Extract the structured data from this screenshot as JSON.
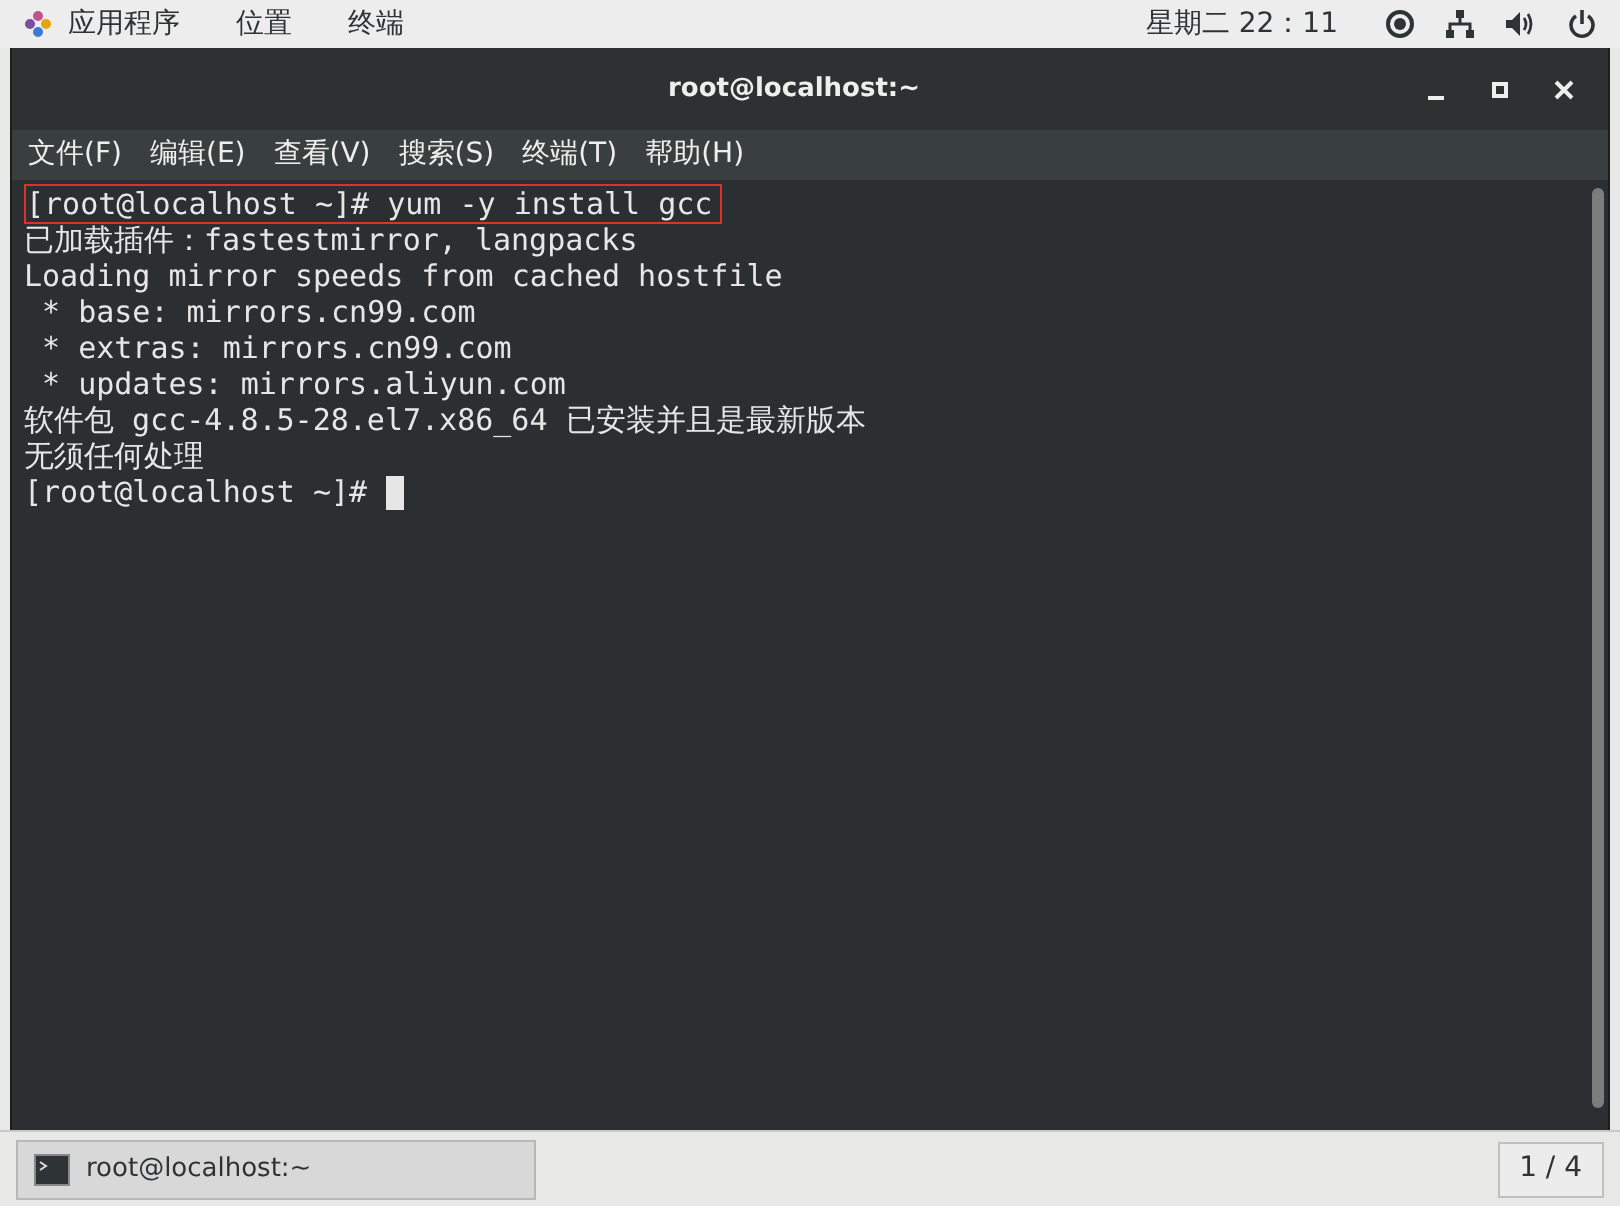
{
  "top_bar": {
    "menus": [
      "应用程序",
      "位置",
      "终端"
    ],
    "clock": "星期二 22：11"
  },
  "window": {
    "title": "root@localhost:~",
    "menu": [
      "文件(F)",
      "编辑(E)",
      "查看(V)",
      "搜索(S)",
      "终端(T)",
      "帮助(H)"
    ]
  },
  "terminal": {
    "lines": [
      {
        "text": "[root@localhost ~]# yum -y install gcc",
        "highlighted": true,
        "cursor": false
      },
      {
        "text": "已加载插件：fastestmirror, langpacks",
        "highlighted": false,
        "cursor": false
      },
      {
        "text": "Loading mirror speeds from cached hostfile",
        "highlighted": false,
        "cursor": false
      },
      {
        "text": " * base: mirrors.cn99.com",
        "highlighted": false,
        "cursor": false
      },
      {
        "text": " * extras: mirrors.cn99.com",
        "highlighted": false,
        "cursor": false
      },
      {
        "text": " * updates: mirrors.aliyun.com",
        "highlighted": false,
        "cursor": false
      },
      {
        "text": "软件包 gcc-4.8.5-28.el7.x86_64 已安装并且是最新版本",
        "highlighted": false,
        "cursor": false
      },
      {
        "text": "无须任何处理",
        "highlighted": false,
        "cursor": false
      },
      {
        "text": "[root@localhost ~]# ",
        "highlighted": false,
        "cursor": true
      }
    ]
  },
  "taskbar": {
    "task": "root@localhost:~",
    "pager": "1 / 4"
  }
}
